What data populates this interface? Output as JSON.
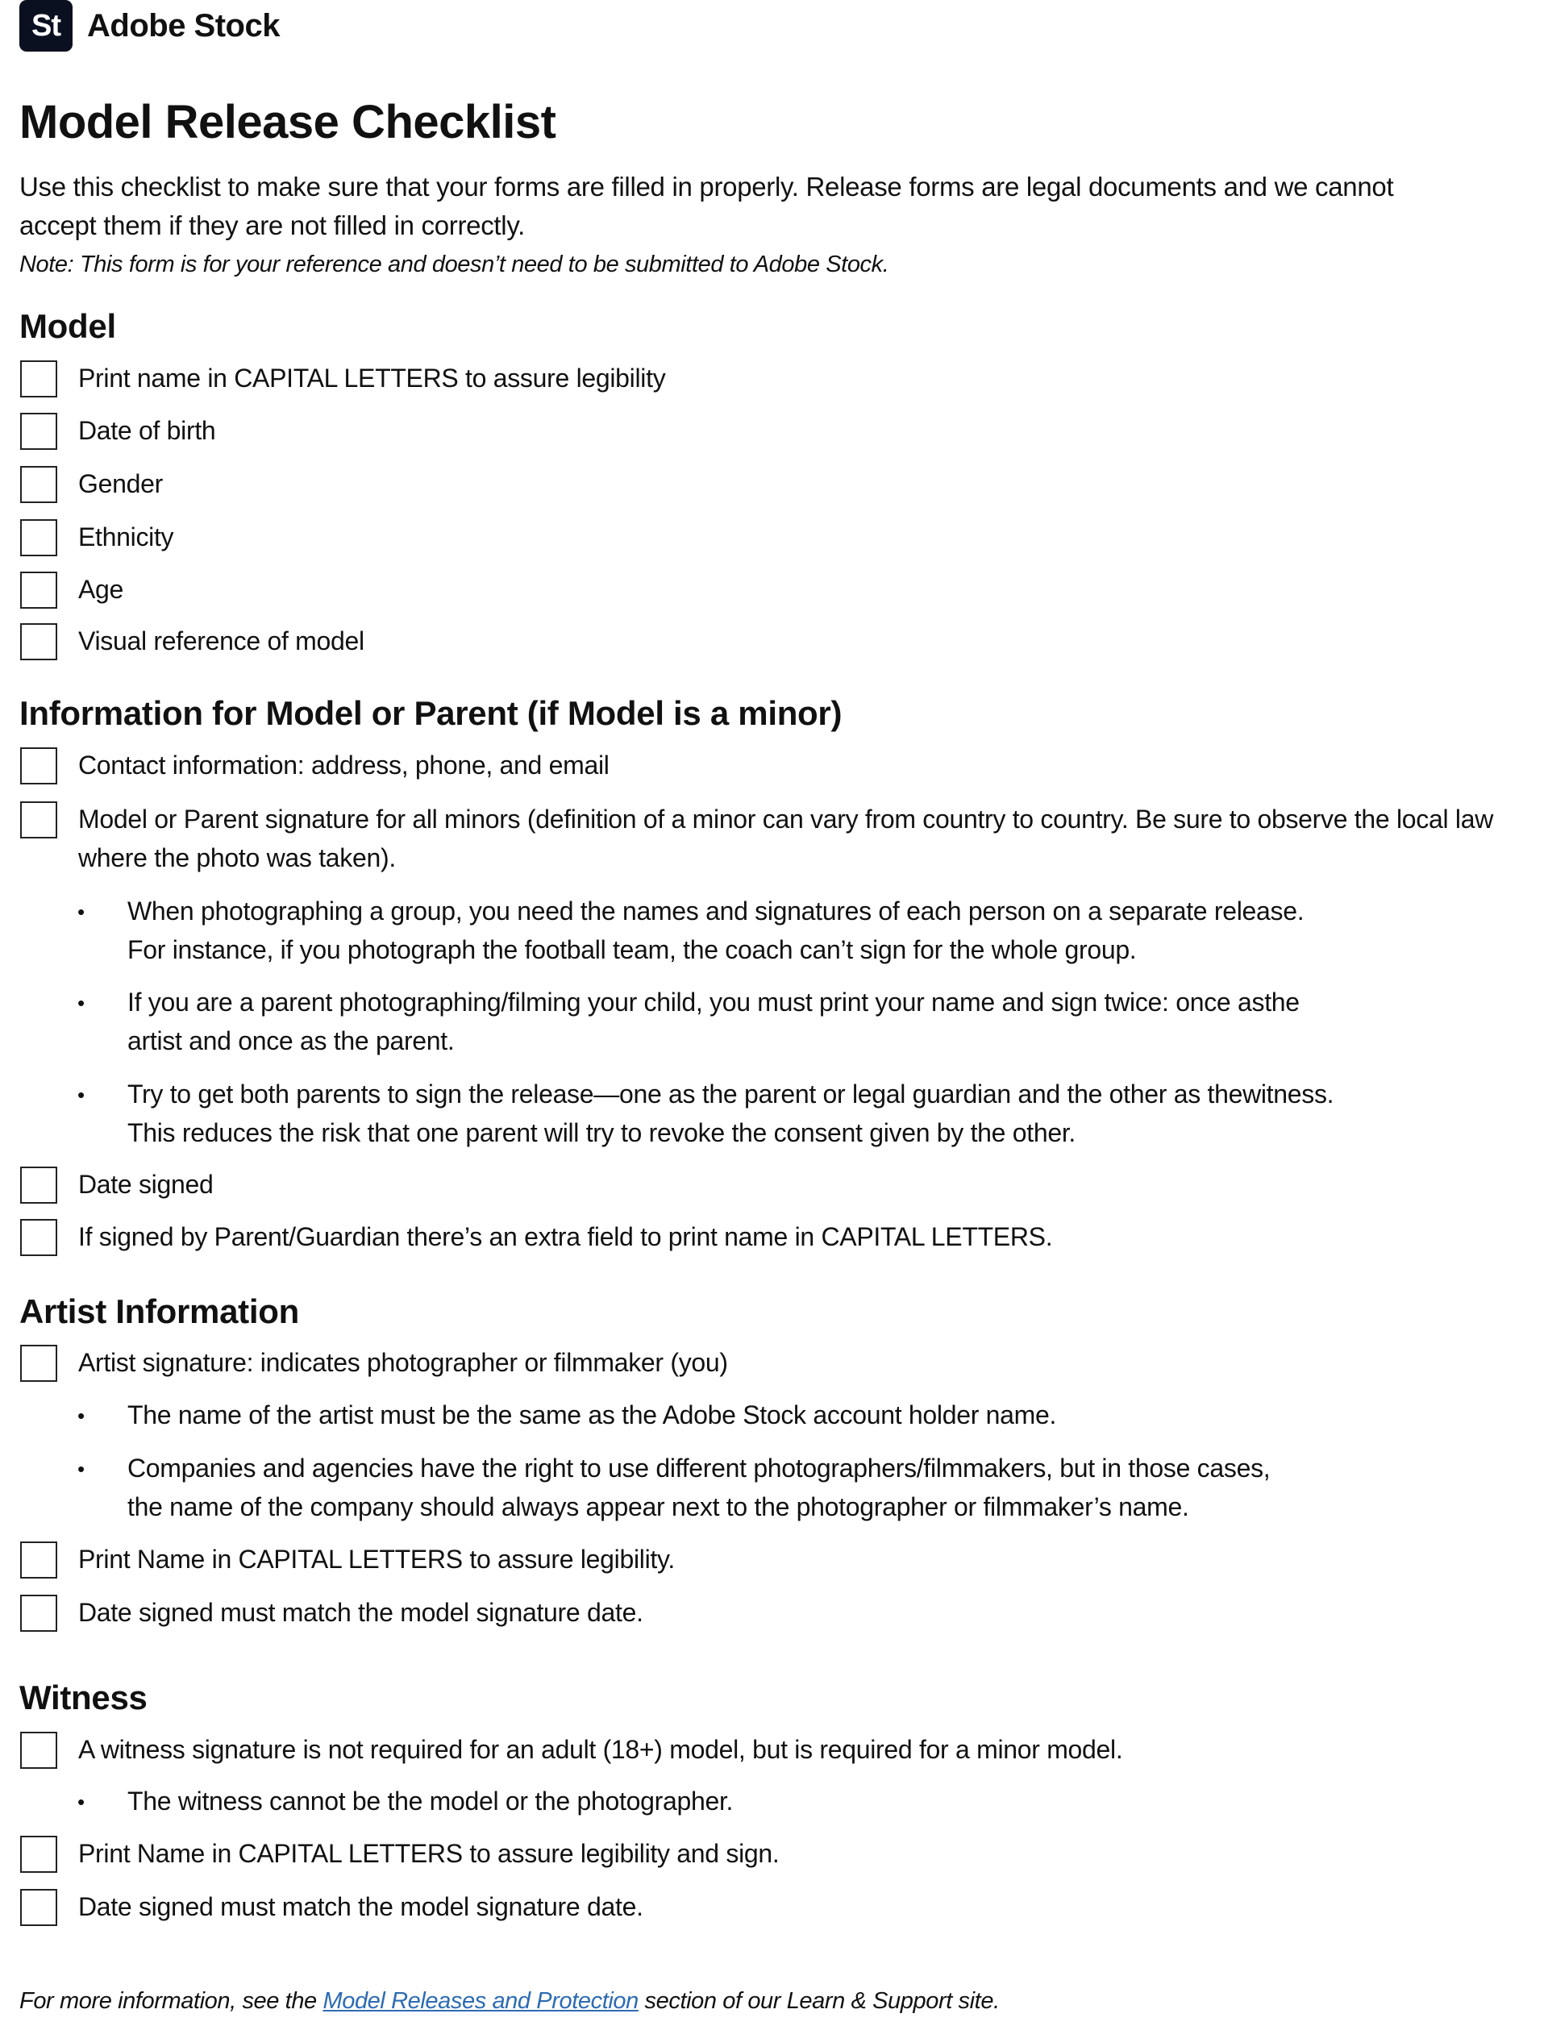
{
  "header": {
    "logo_text": "St",
    "brand_name": "Adobe Stock",
    "logo_color": "#0b1020"
  },
  "page": {
    "title": "Model Release Checklist",
    "intro_line1": "Use this checklist to make sure that your forms are filled in properly. Release forms are legal documents and we cannot",
    "intro_line2": "accept them if they are not filled in correctly.",
    "note": "Note: This form is for your reference and doesn’t need to be submitted to Adobe Stock."
  },
  "sections": {
    "model": {
      "heading": "Model",
      "items": [
        {
          "label": "Print name in CAPITAL LETTERS to assure legibility",
          "checked": false
        },
        {
          "label": "Date of birth",
          "checked": false
        },
        {
          "label": "Gender",
          "checked": false
        },
        {
          "label": "Ethnicity",
          "checked": false
        },
        {
          "label": "Age",
          "checked": false
        },
        {
          "label": "Visual reference of model",
          "checked": false
        }
      ]
    },
    "info": {
      "heading": "Information for Model or Parent (if Model is a minor)",
      "items": [
        {
          "label": "Contact information: address, phone, and email",
          "checked": false
        },
        {
          "label_line1": "Model or Parent signature for all minors (definition of a minor can vary from country to country. Be sure to observe the local law",
          "label_line2": "where the photo was taken).",
          "checked": false
        },
        {
          "label": "Date signed",
          "checked": false
        },
        {
          "label": "If signed by Parent/Guardian there’s an extra field to print name in CAPITAL LETTERS.",
          "checked": false
        }
      ],
      "bullets": [
        {
          "line1": "When photographing a group, you need the names and signatures of each person on a separate release.",
          "line2": "For instance, if you photograph the football team, the coach can’t sign for the whole group."
        },
        {
          "line1": "If you are a parent photographing/filming your child, you must print your name and sign twice: once asthe",
          "line2": "artist and once as the parent."
        },
        {
          "line1": "Try to get both parents to sign the release—one as the parent or legal guardian and the other as thewitness.",
          "line2": "This reduces the risk that one parent will try to revoke the consent given by the other."
        }
      ]
    },
    "artist": {
      "heading": "Artist Information",
      "items": [
        {
          "label": "Artist signature: indicates photographer or filmmaker (you)",
          "checked": false
        },
        {
          "label": "Print Name in CAPITAL LETTERS to assure legibility.",
          "checked": false
        },
        {
          "label": "Date signed must match the model signature date.",
          "checked": false
        }
      ],
      "bullets": [
        {
          "line1": "The name of the artist must be the same as the Adobe Stock account holder name."
        },
        {
          "line1": "Companies and agencies have the right to use different photographers/filmmakers, but in those cases,",
          "line2": "the name of the company should always appear next to the photographer or filmmaker’s name."
        }
      ]
    },
    "witness": {
      "heading": "Witness",
      "items": [
        {
          "label": "A witness signature is not required for an adult (18+) model, but is required for a minor model.",
          "checked": false
        },
        {
          "label": "Print Name in CAPITAL LETTERS to assure legibility and sign.",
          "checked": false
        },
        {
          "label": "Date signed must match the model signature date.",
          "checked": false
        }
      ],
      "bullets": [
        {
          "line1": "The witness cannot be the model or the photographer."
        }
      ]
    }
  },
  "footer": {
    "prefix": "For more information, see the ",
    "link_text": "Model Releases and Protection",
    "suffix": " section of our Learn & Support site.",
    "link_color": "#2d6bb3"
  }
}
